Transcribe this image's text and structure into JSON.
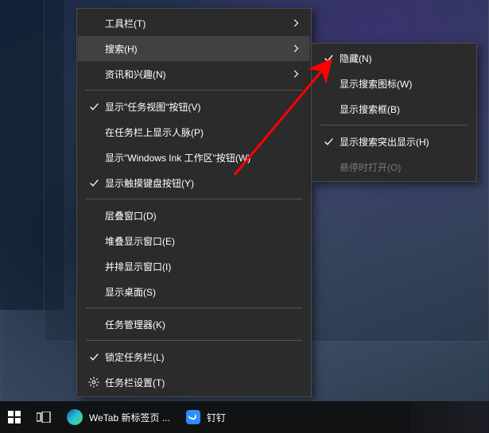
{
  "main_menu": {
    "items": [
      {
        "label": "工具栏(T)",
        "checked": false,
        "submenu": true
      },
      {
        "label": "搜索(H)",
        "checked": false,
        "submenu": true,
        "highlighted": true
      },
      {
        "label": "资讯和兴趣(N)",
        "checked": false,
        "submenu": true
      },
      {
        "sep": true
      },
      {
        "label": "显示\"任务视图\"按钮(V)",
        "checked": true
      },
      {
        "label": "在任务栏上显示人脉(P)",
        "checked": false
      },
      {
        "label": "显示\"Windows Ink 工作区\"按钮(W)",
        "checked": false
      },
      {
        "label": "显示触摸键盘按钮(Y)",
        "checked": true
      },
      {
        "sep": true
      },
      {
        "label": "层叠窗口(D)",
        "checked": false
      },
      {
        "label": "堆叠显示窗口(E)",
        "checked": false
      },
      {
        "label": "并排显示窗口(I)",
        "checked": false
      },
      {
        "label": "显示桌面(S)",
        "checked": false
      },
      {
        "sep": true
      },
      {
        "label": "任务管理器(K)",
        "checked": false
      },
      {
        "sep": true
      },
      {
        "label": "锁定任务栏(L)",
        "checked": true
      },
      {
        "label": "任务栏设置(T)",
        "checked": false,
        "icon": "gear"
      }
    ]
  },
  "sub_menu": {
    "items": [
      {
        "label": "隐藏(N)",
        "checked": true
      },
      {
        "label": "显示搜索图标(W)",
        "checked": false
      },
      {
        "label": "显示搜索框(B)",
        "checked": false
      },
      {
        "sep": true
      },
      {
        "label": "显示搜索突出显示(H)",
        "checked": true
      },
      {
        "label": "悬停时打开(O)",
        "checked": false,
        "disabled": true
      }
    ]
  },
  "taskbar": {
    "app1": {
      "title": "WeTab 新标签页 ..."
    },
    "app2": {
      "title": "钉钉"
    }
  }
}
